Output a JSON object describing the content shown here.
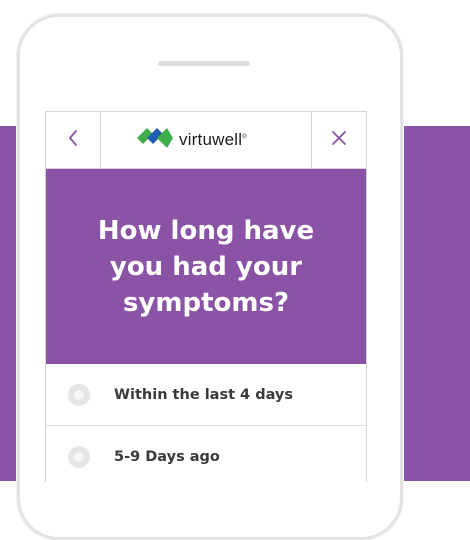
{
  "brand": {
    "name": "virtuwell",
    "trademark": "®",
    "colors": {
      "primary": "#8a53a5",
      "logo_green": "#3fae4a",
      "logo_blue": "#1e5fb4"
    }
  },
  "header": {
    "back_icon": "chevron-left-icon",
    "close_icon": "close-icon",
    "icon_color": "#8a53a5"
  },
  "question": {
    "text": "How long have you had your symptoms?"
  },
  "options": [
    {
      "label": "Within the last 4 days"
    },
    {
      "label": "5-9 Days ago"
    }
  ]
}
